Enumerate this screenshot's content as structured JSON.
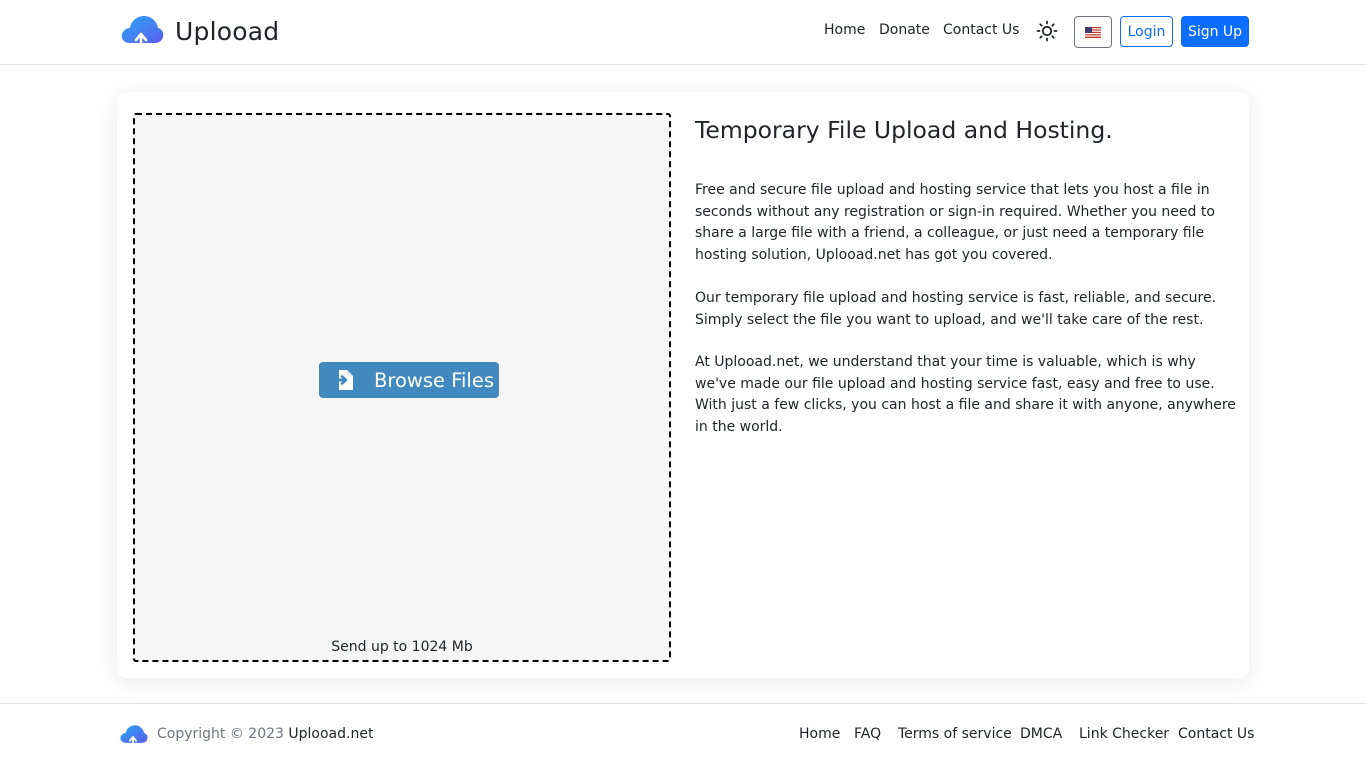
{
  "header": {
    "brand_name": "Uplooad",
    "nav": [
      "Home",
      "Donate",
      "Contact Us"
    ],
    "theme_icon": "sun-icon",
    "language_icon": "us-flag-icon",
    "login_label": "Login",
    "signup_label": "Sign Up"
  },
  "upload": {
    "browse_label": "Browse Files",
    "limit_text": "Send up to 1024 Mb"
  },
  "content": {
    "title": "Temporary File Upload and Hosting.",
    "paragraphs": [
      "Free and secure file upload and hosting service that lets you host a file in seconds without any registration or sign-in required. Whether you need to share a large file with a friend, a colleague, or just need a temporary file hosting solution, Uplooad.net has got you covered.",
      "Our temporary file upload and hosting service is fast, reliable, and secure. Simply select the file you want to upload, and we'll take care of the rest.",
      "At Uplooad.net, we understand that your time is valuable, which is why we've made our file upload and hosting service fast, easy and free to use. With just a few clicks, you can host a file and share it with anyone, anywhere in the world."
    ]
  },
  "footer": {
    "copyright_prefix": "Copyright © 2023",
    "site_name": "Uplooad.net",
    "links": [
      "Home",
      "FAQ",
      "Terms of service",
      "DMCA",
      "Link Checker",
      "Contact Us"
    ]
  },
  "colors": {
    "primary": "#0d6efd",
    "browse_button": "#4189bf",
    "dropzone_bg": "#f6f6f6"
  }
}
